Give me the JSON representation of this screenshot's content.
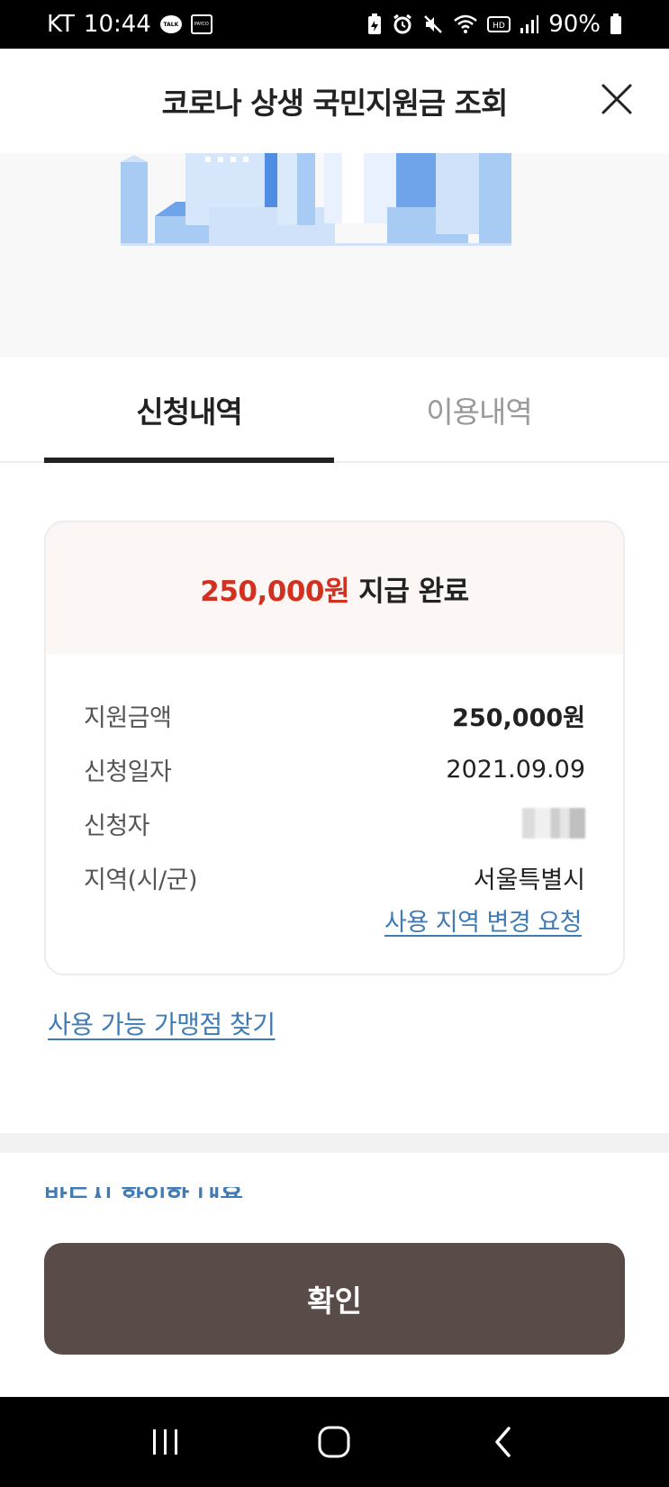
{
  "status_bar": {
    "carrier": "KT",
    "time": "10:44",
    "talk_label": "TALK",
    "payco_label": "PAYCO",
    "battery": "90%"
  },
  "header": {
    "title": "코로나 상생 국민지원금 조회"
  },
  "tabs": [
    {
      "label": "신청내역",
      "active": true
    },
    {
      "label": "이용내역",
      "active": false
    }
  ],
  "summary": {
    "amount": "250,000원",
    "status": " 지급 완료"
  },
  "details": [
    {
      "label": "지원금액",
      "value": "250,000원",
      "bold": true
    },
    {
      "label": "신청일자",
      "value": "2021.09.09"
    },
    {
      "label": "신청자",
      "value": ""
    },
    {
      "label": "지역(시/군)",
      "value": "서울특별시"
    }
  ],
  "links": {
    "change_region": "사용 지역 변경 요청",
    "find_stores": "사용 가능 가맹점 찾기"
  },
  "notice_peek": "반드시 확인할 내용",
  "confirm_button": "확인",
  "colors": {
    "accent_red": "#d3301f",
    "link_blue": "#3f7bb5",
    "button_brown": "#594b48",
    "card_head_bg": "#fcf6f5"
  }
}
